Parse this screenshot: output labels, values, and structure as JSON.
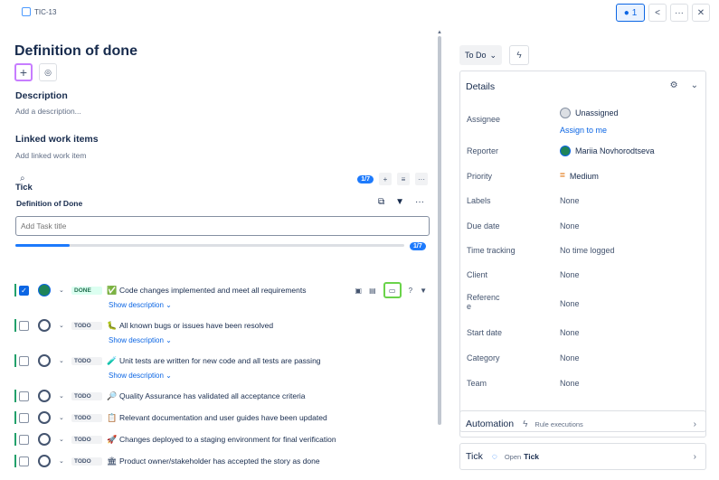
{
  "header": {
    "issue_key": "TIC-13",
    "watch_count": "1",
    "share_icon": "share-icon",
    "more_icon": "more-icon",
    "close_icon": "close-icon"
  },
  "issue": {
    "title": "Definition of done",
    "add_icon": "plus-icon",
    "apps_icon": "apps-icon"
  },
  "description": {
    "heading": "Description",
    "placeholder": "Add a description..."
  },
  "linked": {
    "heading": "Linked work items",
    "placeholder": "Add linked work item"
  },
  "tick": {
    "heading": "Tick",
    "progress_label": "1/7",
    "progress": 0.14,
    "checklist_title": "Definition of Done",
    "add_task_placeholder": "Add Task title",
    "show_description": "Show description",
    "tasks": [
      {
        "status": "DONE",
        "text": "Code changes implemented and meet all requirements",
        "checked": true,
        "emoji": "✅",
        "avatar": "photo"
      },
      {
        "status": "TODO",
        "text": "All known bugs or issues have been resolved",
        "checked": false,
        "emoji": "🐛",
        "avatar": "person"
      },
      {
        "status": "TODO",
        "text": "Unit tests are written for new code and all tests are passing",
        "checked": false,
        "emoji": "🧪",
        "avatar": "person"
      },
      {
        "status": "TODO",
        "text": "Quality Assurance has validated all acceptance criteria",
        "checked": false,
        "emoji": "🔎",
        "avatar": "person"
      },
      {
        "status": "TODO",
        "text": "Relevant documentation and user guides have been updated",
        "checked": false,
        "emoji": "📋",
        "avatar": "person"
      },
      {
        "status": "TODO",
        "text": "Changes deployed to a staging environment for final verification",
        "checked": false,
        "emoji": "🚀",
        "avatar": "person"
      },
      {
        "status": "TODO",
        "text": "Product owner/stakeholder has accepted the story as done",
        "checked": false,
        "emoji": "🏛",
        "avatar": "person"
      }
    ]
  },
  "sidebar": {
    "status_label": "To Do",
    "details_heading": "Details",
    "fields": [
      {
        "label": "Assignee",
        "value": "Unassigned",
        "link": "Assign to me"
      },
      {
        "label": "Reporter",
        "value": "Mariia Novhorodtseva"
      },
      {
        "label": "Priority",
        "value": "Medium"
      },
      {
        "label": "Labels",
        "value": "None"
      },
      {
        "label": "Due date",
        "value": "None"
      },
      {
        "label": "Time tracking",
        "value": "No time logged"
      },
      {
        "label": "Client",
        "value": "None"
      },
      {
        "label": "Referenc",
        "label2": "e",
        "value": "None"
      },
      {
        "label": "Start date",
        "value": "None"
      },
      {
        "label": "Category",
        "value": "None"
      },
      {
        "label": "Team",
        "value": "None"
      }
    ],
    "automation": {
      "title": "Automation",
      "sub": "Rule executions"
    },
    "tick_panel": {
      "title": "Tick",
      "open_label": "Open",
      "open_target": "Tick"
    }
  }
}
